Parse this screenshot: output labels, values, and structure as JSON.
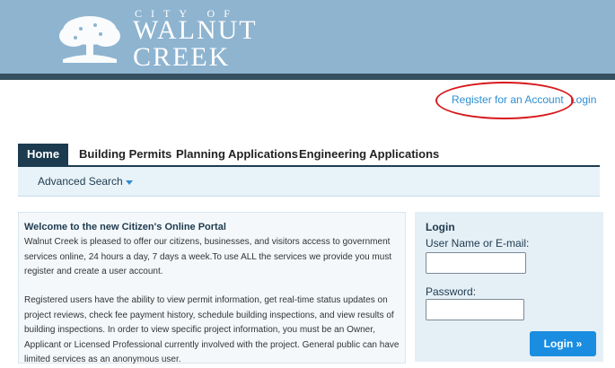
{
  "header": {
    "city_label": "CITY OF",
    "name_line1": "WALNUT",
    "name_line2": "CREEK"
  },
  "top_links": {
    "register": "Register for an Account",
    "login": "Login"
  },
  "nav": {
    "tabs": [
      {
        "label": "Home"
      },
      {
        "label": "Building Permits"
      },
      {
        "label": "Planning Applications"
      },
      {
        "label": "Engineering Applications"
      }
    ]
  },
  "advanced_search": {
    "label": "Advanced Search"
  },
  "welcome": {
    "title": "Welcome to the new Citizen's Online Portal",
    "paragraph1": "Walnut Creek is pleased to offer our citizens, businesses, and visitors access to government services online, 24 hours a day, 7 days a week.To use ALL the services we provide you must register and create a user account.",
    "paragraph2": "Registered users have the ability to view permit information, get real-time status updates on project reviews, check fee payment history, schedule building inspections, and view results of building inspections.  In order to view specific project information, you must be an Owner, Applicant or Licensed Professional currently involved with the project.  General public can have limited services as an anonymous user."
  },
  "login_panel": {
    "title": "Login",
    "username_label": "User Name or E-mail:",
    "username_value": "",
    "password_label": "Password:",
    "password_value": "",
    "button_label": "Login »"
  },
  "colors": {
    "banner": "#8eb4d0",
    "nav_active": "#1d3b4f",
    "link": "#2d8fd3",
    "button": "#1a8de0",
    "annotation_circle": "#d8191c"
  }
}
